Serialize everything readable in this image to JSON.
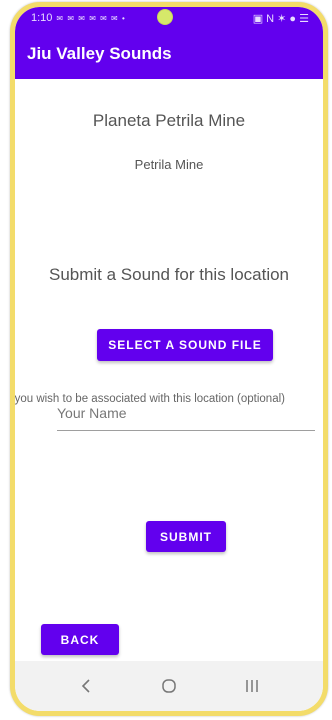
{
  "status_bar": {
    "time": "1:10",
    "notification_icons": "✉ ✉ ✉ ✉ ✉ ✉ •",
    "right_icons": "▣ N ✶ ● ☰"
  },
  "app_bar": {
    "title": "Jiu Valley Sounds"
  },
  "location": {
    "name": "Planeta Petrila Mine",
    "subtitle": "Petrila Mine"
  },
  "submit": {
    "heading": "Submit a Sound for this location",
    "select_file_label": "SELECT A SOUND FILE",
    "optional_text": "If you wish to be associated with this location (optional)",
    "name_placeholder": "Your Name",
    "submit_label": "SUBMIT"
  },
  "back_label": "BACK",
  "colors": {
    "primary": "#6200ee",
    "frame": "#f3dc6a",
    "text": "#555555"
  },
  "nav": {
    "back_icon": "chevron-left-icon",
    "home_icon": "circle-home-icon",
    "recents_icon": "recents-icon"
  }
}
